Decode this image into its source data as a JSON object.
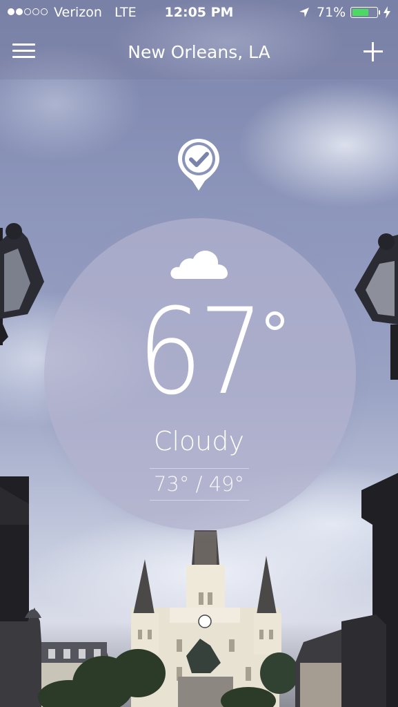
{
  "status_bar": {
    "carrier": "Verizon",
    "network": "LTE",
    "time": "12:05 PM",
    "battery_percent": "71%",
    "battery_level": 0.71,
    "signal_bars_filled": 2,
    "signal_bars_total": 5,
    "icons": [
      "location-arrow-icon",
      "battery-icon",
      "charging-bolt-icon"
    ]
  },
  "header": {
    "title": "New Orleans, LA",
    "menu_icon": "hamburger-menu-icon",
    "add_icon": "plus-icon"
  },
  "location_marker": {
    "icon": "location-pin-check-icon"
  },
  "weather": {
    "condition_icon": "cloud-icon",
    "temperature": "67",
    "condition": "Cloudy",
    "high_low": "73° / 49°"
  },
  "colors": {
    "battery_fill": "#4cd964",
    "text": "#ffffff",
    "circle": "#b2b2cd"
  }
}
